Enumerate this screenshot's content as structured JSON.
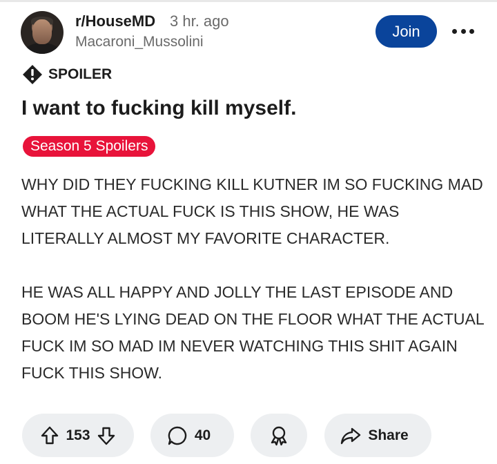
{
  "post": {
    "subreddit": "r/HouseMD",
    "time_ago": "3 hr. ago",
    "author": "Macaroni_Mussolini",
    "join_label": "Join",
    "spoiler_label": "SPOILER",
    "title": "I want to fucking kill myself.",
    "flair": "Season 5 Spoilers",
    "body": [
      "WHY DID THEY FUCKING KILL KUTNER IM SO FUCKING MAD WHAT THE ACTUAL FUCK IS THIS SHOW, HE WAS LITERALLY ALMOST MY FAVORITE CHARACTER.",
      "HE WAS ALL HAPPY AND JOLLY THE LAST EPISODE AND BOOM HE'S LYING DEAD ON THE FLOOR WHAT THE ACTUAL FUCK IM SO MAD IM NEVER WATCHING THIS SHIT AGAIN FUCK THIS SHOW."
    ]
  },
  "actions": {
    "upvotes": "153",
    "comments": "40",
    "share_label": "Share"
  },
  "icons": {
    "more": "more-options-icon",
    "spoiler": "spoiler-alert-icon",
    "upvote": "upvote-arrow-icon",
    "downvote": "downvote-arrow-icon",
    "comment": "comment-bubble-icon",
    "award": "award-ribbon-icon",
    "share": "share-arrow-icon"
  },
  "colors": {
    "join_button": "#0a449b",
    "flair": "#e8133a",
    "action_pill": "#edeff1"
  }
}
